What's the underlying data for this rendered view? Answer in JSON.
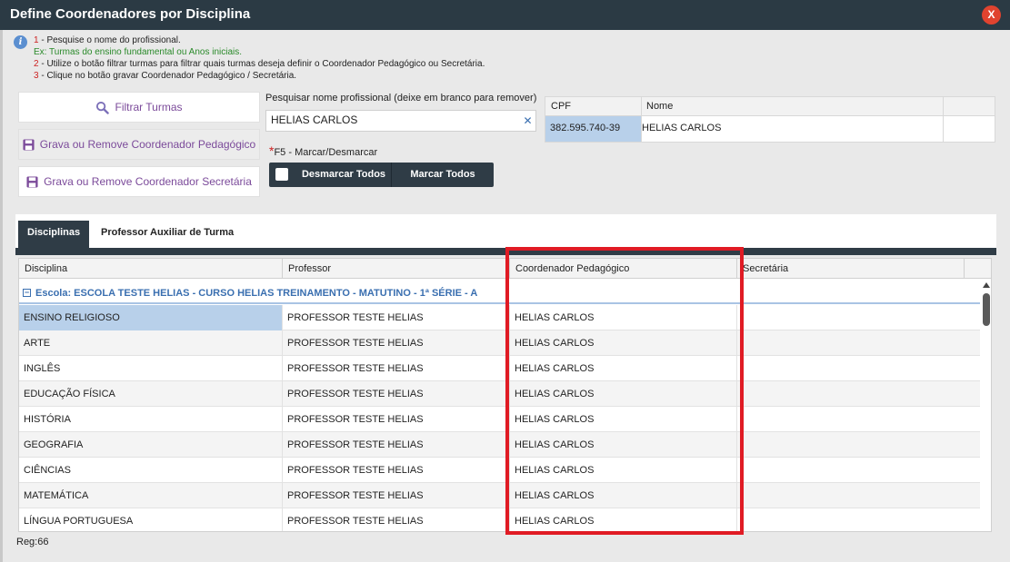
{
  "window": {
    "title": "Define Coordenadores por Disciplina",
    "close_label": "X"
  },
  "instructions": {
    "info_icon": "i",
    "lines": [
      {
        "num": "1",
        "text": " - Pesquise o nome do profissional."
      },
      {
        "example": "Ex: Turmas do ensino fundamental ou Anos iniciais."
      },
      {
        "num": "2",
        "text": " - Utilize o botão filtrar turmas para filtrar quais turmas deseja definir o Coordenador Pedagógico ou Secretária."
      },
      {
        "num": "3",
        "text": " - Clique no botão gravar Coordenador Pedagógico / Secretária."
      }
    ]
  },
  "buttons": {
    "filtrar": "Filtrar Turmas",
    "grava_coord": "Grava ou Remove Coordenador Pedagógico",
    "grava_secret": "Grava ou Remove Coordenador Secretária"
  },
  "search": {
    "label": "Pesquisar nome profissional (deixe em branco para remover)",
    "value": "HELIAS CARLOS",
    "clear_label": "✕"
  },
  "f5_note": {
    "asterisk": "*",
    "text": "F5 - Marcar/Desmarcar"
  },
  "mark_bar": {
    "desmarcar": "Desmarcar Todos",
    "marcar": "Marcar Todos"
  },
  "cpf_table": {
    "headers": {
      "cpf": "CPF",
      "nome": "Nome"
    },
    "row": {
      "cpf": "382.595.740-39",
      "nome": "HELIAS CARLOS"
    }
  },
  "tabs": {
    "disciplinas": "Disciplinas",
    "auxiliar": "Professor Auxiliar de Turma"
  },
  "grid": {
    "headers": {
      "disciplina": "Disciplina",
      "professor": "Professor",
      "coordenador": "Coordenador Pedagógico",
      "secretaria": "Secretária"
    },
    "group": {
      "toggle": "−",
      "label": "Escola: ESCOLA TESTE HELIAS - CURSO HELIAS TREINAMENTO - MATUTINO - 1ª SÉRIE - A"
    },
    "rows": [
      {
        "disciplina": "ENSINO RELIGIOSO",
        "professor": "PROFESSOR TESTE HELIAS",
        "coordenador": "HELIAS CARLOS",
        "secretaria": ""
      },
      {
        "disciplina": "ARTE",
        "professor": "PROFESSOR TESTE HELIAS",
        "coordenador": "HELIAS CARLOS",
        "secretaria": ""
      },
      {
        "disciplina": "INGLÊS",
        "professor": "PROFESSOR TESTE HELIAS",
        "coordenador": "HELIAS CARLOS",
        "secretaria": ""
      },
      {
        "disciplina": "EDUCAÇÃO FÍSICA",
        "professor": "PROFESSOR TESTE HELIAS",
        "coordenador": "HELIAS CARLOS",
        "secretaria": ""
      },
      {
        "disciplina": "HISTÓRIA",
        "professor": "PROFESSOR TESTE HELIAS",
        "coordenador": "HELIAS CARLOS",
        "secretaria": ""
      },
      {
        "disciplina": "GEOGRAFIA",
        "professor": "PROFESSOR TESTE HELIAS",
        "coordenador": "HELIAS CARLOS",
        "secretaria": ""
      },
      {
        "disciplina": "CIÊNCIAS",
        "professor": "PROFESSOR TESTE HELIAS",
        "coordenador": "HELIAS CARLOS",
        "secretaria": ""
      },
      {
        "disciplina": "MATEMÁTICA",
        "professor": "PROFESSOR TESTE HELIAS",
        "coordenador": "HELIAS CARLOS",
        "secretaria": ""
      },
      {
        "disciplina": "LÍNGUA PORTUGUESA",
        "professor": "PROFESSOR TESTE HELIAS",
        "coordenador": "HELIAS CARLOS",
        "secretaria": ""
      }
    ]
  },
  "footer": {
    "reg": "Reg:66"
  },
  "colors": {
    "titlebar": "#2b3a44",
    "close": "#e0432f",
    "accent_purple": "#7b4a9a",
    "highlight": "#e01b24",
    "selected_cell": "#b8d0ea"
  }
}
